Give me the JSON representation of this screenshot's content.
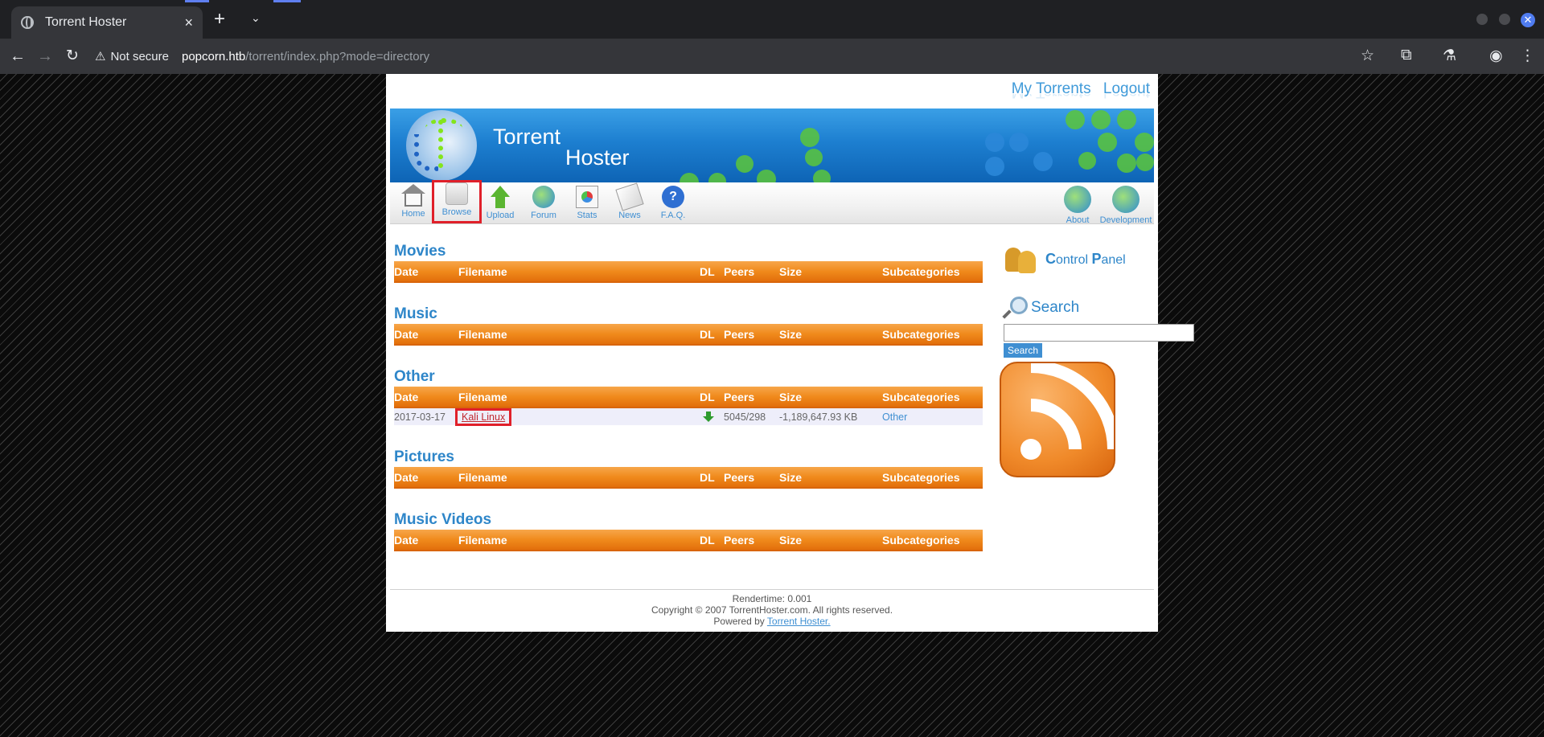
{
  "browser": {
    "tab_title": "Torrent Hoster",
    "tab_close": "×",
    "new_tab": "+",
    "tab_menu": "⌄",
    "not_secure": "Not secure",
    "url_host": "popcorn.htb",
    "url_path": "/torrent/index.php?mode=directory",
    "window_close": "✕"
  },
  "site": {
    "top_links": [
      "My Torrents",
      "Logout"
    ],
    "banner_title_1": "Torrent",
    "banner_title_2": "Hoster",
    "menu": [
      {
        "label": "Home",
        "icon": "home-icon"
      },
      {
        "label": "Browse",
        "icon": "browse-icon",
        "selected": true
      },
      {
        "label": "Upload",
        "icon": "upload-icon"
      },
      {
        "label": "Forum",
        "icon": "forum-icon"
      },
      {
        "label": "Stats",
        "icon": "stats-icon"
      },
      {
        "label": "News",
        "icon": "news-icon"
      },
      {
        "label": "F.A.Q.",
        "icon": "faq-icon",
        "glyph": "?"
      }
    ],
    "menu_right": [
      {
        "label": "About",
        "icon": "about-icon"
      },
      {
        "label": "Development",
        "icon": "development-icon"
      }
    ]
  },
  "columns": [
    "Date",
    "Filename",
    "DL",
    "Peers",
    "Size",
    "Subcategories"
  ],
  "categories": [
    {
      "name": "Movies",
      "rows": []
    },
    {
      "name": "Music",
      "rows": []
    },
    {
      "name": "Other",
      "rows": [
        {
          "date": "2017-03-17",
          "filename": "Kali Linux",
          "peers": "5045/298",
          "size": "-1,189,647.93 KB",
          "subcategory": "Other"
        }
      ]
    },
    {
      "name": "Pictures",
      "rows": []
    },
    {
      "name": "Music Videos",
      "rows": []
    }
  ],
  "sidebar": {
    "control_panel_first": "C",
    "control_panel_mid": "ontrol ",
    "control_panel_p": "P",
    "control_panel_last": "anel",
    "search_heading": "Search",
    "search_button": "Search"
  },
  "footer": {
    "rendertime": "Rendertime: 0.001",
    "copyright": "Copyright © 2007 TorrentHoster.com. All rights reserved.",
    "powered_prefix": "Powered by ",
    "powered_link": "Torrent Hoster."
  },
  "colors": {
    "accent": "#2e86c9",
    "header_orange": "#f08a1c",
    "highlight_red": "#e0202a"
  }
}
